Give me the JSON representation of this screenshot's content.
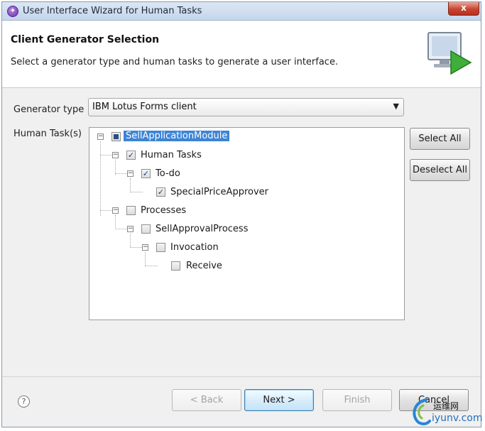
{
  "window": {
    "title": "User Interface Wizard for Human Tasks",
    "close_label": "x"
  },
  "header": {
    "title": "Client Generator Selection",
    "description": "Select a generator type and human tasks to generate a user interface."
  },
  "form": {
    "generator_label": "Generator type",
    "generator_value": "IBM Lotus Forms client",
    "tasks_label": "Human Task(s)"
  },
  "tree": {
    "nodes": [
      {
        "label": "SellApplicationModule",
        "checked": "partial",
        "selected": true
      },
      {
        "label": "Human Tasks",
        "checked": true
      },
      {
        "label": "To-do",
        "checked": true
      },
      {
        "label": "SpecialPriceApprover",
        "checked": true
      },
      {
        "label": "Processes",
        "checked": false
      },
      {
        "label": "SellApprovalProcess",
        "checked": false
      },
      {
        "label": "Invocation",
        "checked": false
      },
      {
        "label": "Receive",
        "checked": false
      }
    ]
  },
  "side_buttons": {
    "select_all": "Select All",
    "deselect_all": "Deselect All"
  },
  "footer": {
    "help": "?",
    "back": "< Back",
    "next": "Next >",
    "finish": "Finish",
    "cancel": "Cancel"
  },
  "watermark": {
    "line1": "运维网",
    "line2": "iyunv.com"
  },
  "colors": {
    "selection": "#3d84d6",
    "default_button_border": "#3c7fb1"
  },
  "icons": {
    "app": "wizard-app-icon",
    "banner": "wizard-banner-icon",
    "dropdown": "chevron-down-icon",
    "help": "help-icon"
  }
}
